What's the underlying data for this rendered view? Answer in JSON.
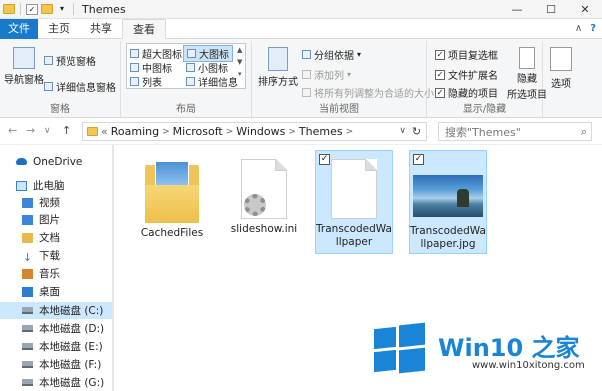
{
  "titlebar": {
    "title": "Themes",
    "controls": [
      "—",
      "☐",
      "✕"
    ]
  },
  "tabs": [
    {
      "label": "文件"
    },
    {
      "label": "主页"
    },
    {
      "label": "共享"
    },
    {
      "label": "查看"
    }
  ],
  "ribbon": {
    "pane": {
      "nav_pane": "导航窗格",
      "preview_pane": "预览窗格",
      "details_pane": "详细信息窗格",
      "label": "窗格"
    },
    "layout": {
      "items": [
        "超大图标",
        "大图标",
        "中图标",
        "小图标",
        "列表",
        "详细信息"
      ],
      "selected": "大图标",
      "label": "布局"
    },
    "current_view": {
      "sort_by": "排序方式",
      "group_by": "分组依据",
      "add_column": "添加列",
      "fit_columns": "将所有列调整为合适的大小",
      "label": "当前视图"
    },
    "show_hide": {
      "item_checkboxes": "项目复选框",
      "file_extensions": "文件扩展名",
      "hidden_items": "隐藏的项目",
      "hide_selected": "隐藏",
      "hide_selected_2": "所选项目",
      "label": "显示/隐藏"
    },
    "options": "选项"
  },
  "address": {
    "prefix": "«",
    "crumbs": [
      "Roaming",
      "Microsoft",
      "Windows",
      "Themes"
    ],
    "search_placeholder": "搜索\"Themes\""
  },
  "nav": [
    {
      "label": "OneDrive",
      "icon": "cloud-icon"
    },
    {
      "label": "此电脑",
      "icon": "pc-icon"
    },
    {
      "label": "视频",
      "icon": "video-folder-icon"
    },
    {
      "label": "图片",
      "icon": "pictures-folder-icon"
    },
    {
      "label": "文档",
      "icon": "documents-folder-icon"
    },
    {
      "label": "下载",
      "icon": "download-icon"
    },
    {
      "label": "音乐",
      "icon": "music-icon"
    },
    {
      "label": "桌面",
      "icon": "desktop-icon"
    },
    {
      "label": "本地磁盘 (C:)",
      "icon": "drive-icon"
    },
    {
      "label": "本地磁盘 (D:)",
      "icon": "drive-icon"
    },
    {
      "label": "本地磁盘 (E:)",
      "icon": "drive-icon"
    },
    {
      "label": "本地磁盘 (F:)",
      "icon": "drive-icon"
    },
    {
      "label": "本地磁盘 (G:)",
      "icon": "drive-icon"
    }
  ],
  "files": [
    {
      "name": "CachedFiles",
      "type": "folder",
      "selected": false
    },
    {
      "name": "slideshow.ini",
      "type": "ini",
      "selected": false
    },
    {
      "name": "TranscodedWallpaper",
      "type": "file",
      "selected": true
    },
    {
      "name": "TranscodedWallpaper.jpg",
      "type": "image",
      "selected": true
    }
  ],
  "watermark": {
    "title": "Win10 之家",
    "url": "www.win10xitong.com"
  },
  "colors": {
    "accent": "#1979ca",
    "selection": "#cce8ff",
    "watermark": "#1a84d6"
  }
}
